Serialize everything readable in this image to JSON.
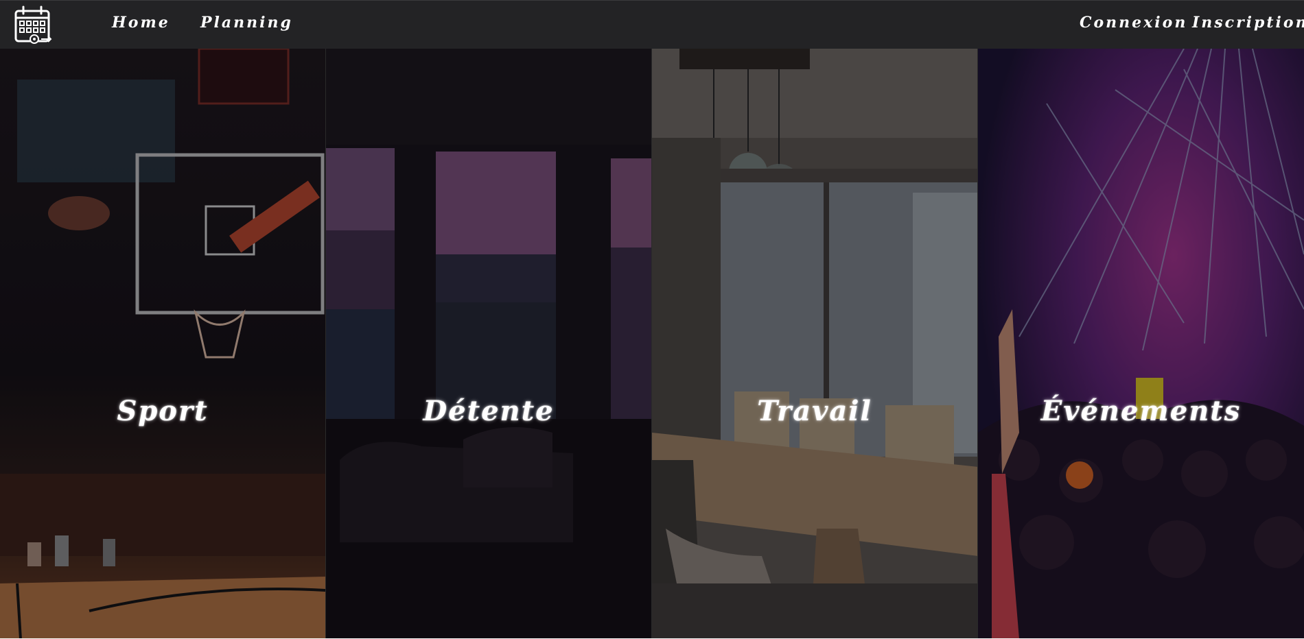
{
  "nav": {
    "logo_icon": "calendar-gear-icon",
    "home": "Home",
    "planning": "Planning",
    "login": "Connexion",
    "signup": "Inscription"
  },
  "panels": [
    {
      "label": "Sport",
      "scene": "basketball-court-image"
    },
    {
      "label": "Détente",
      "scene": "living-room-window-image"
    },
    {
      "label": "Travail",
      "scene": "meeting-room-image"
    },
    {
      "label": "Événements",
      "scene": "concert-crowd-image"
    }
  ],
  "colors": {
    "navbar": "#232325",
    "text": "#ffffff"
  }
}
